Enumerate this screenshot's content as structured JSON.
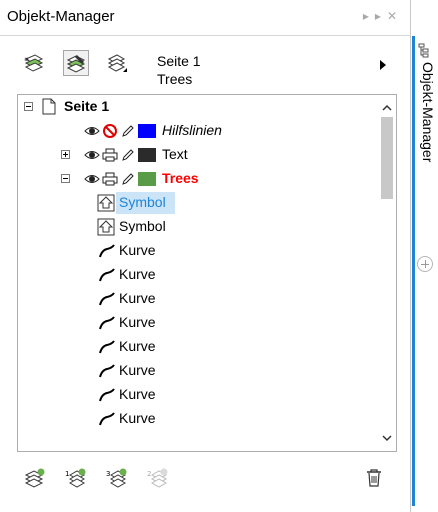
{
  "panel": {
    "title": "Objekt-Manager",
    "title_controls": [
      "▸▸",
      "✕"
    ]
  },
  "toolbar": {
    "page_name": "Seite 1",
    "layer_name": "Trees"
  },
  "tree": {
    "root": {
      "label": "Seite 1",
      "expanded": true
    },
    "layers": [
      {
        "label": "Hilfslinien",
        "color": "#0000ff",
        "italic": true,
        "print_disabled": true,
        "expanded": null
      },
      {
        "label": "Text",
        "color": "#2b2b2b",
        "italic": false,
        "print_disabled": false,
        "expanded": false
      },
      {
        "label": "Trees",
        "color": "#5a9b48",
        "italic": false,
        "print_disabled": false,
        "expanded": true,
        "active": true,
        "label_color": "#ff0000"
      }
    ],
    "objects": [
      {
        "label": "Symbol",
        "type": "symbol",
        "selected": true
      },
      {
        "label": "Symbol",
        "type": "symbol",
        "selected": false
      },
      {
        "label": "Kurve",
        "type": "curve"
      },
      {
        "label": "Kurve",
        "type": "curve"
      },
      {
        "label": "Kurve",
        "type": "curve"
      },
      {
        "label": "Kurve",
        "type": "curve"
      },
      {
        "label": "Kurve",
        "type": "curve"
      },
      {
        "label": "Kurve",
        "type": "curve"
      },
      {
        "label": "Kurve",
        "type": "curve"
      },
      {
        "label": "Kurve",
        "type": "curve"
      }
    ]
  },
  "side_tab": {
    "label": "Objekt-Manager",
    "accent_color": "#1e84d6"
  },
  "colors": {
    "selection": "#cce4f7",
    "selection_text": "#1e84d6",
    "active_layer": "#ff0000"
  }
}
